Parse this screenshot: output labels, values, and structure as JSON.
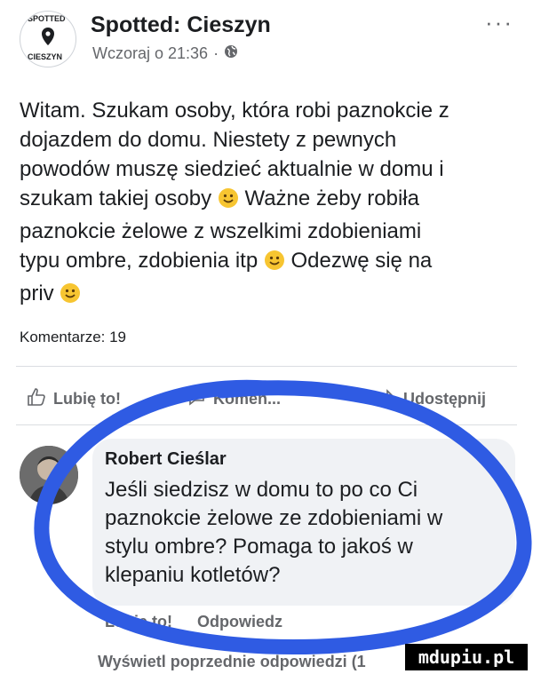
{
  "header": {
    "page_name": "Spotted: Cieszyn",
    "timestamp": "Wczoraj o 21:36",
    "separator": "·",
    "privacy_icon": "globe-icon",
    "more_label": "···",
    "logo_top_text": "SPOTTED",
    "logo_bottom_text": "CIESZYN"
  },
  "post": {
    "line1": "Witam. Szukam osoby, która robi paznokcie z",
    "line2": "dojazdem do domu. Niestety z pewnych",
    "line3": "powodów muszę siedzieć aktualnie w domu i",
    "line4a": "szukam takiej osoby",
    "line4b": "Ważne żeby robiła",
    "line5": "paznokcie żelowe z wszelkimi zdobieniami",
    "line6a": "typu ombre, zdobienia itp",
    "line6b": "Odezwę się na",
    "line7": "priv"
  },
  "stats": {
    "comments_label": "Komentarze: 19"
  },
  "actions": {
    "like": "Lubię to!",
    "comment": "Komen...",
    "share": "Udostępnij"
  },
  "comment": {
    "author": "Robert Cieślar",
    "line1": "Jeśli siedzisz w domu to po co Ci",
    "line2": "paznokcie żelowe ze zdobieniami w",
    "line3": "stylu ombre? Pomaga to jakoś w",
    "line4": "klepaniu kotletów?",
    "like": "Lubię to!",
    "reply": "Odpowiedz"
  },
  "more_replies": {
    "label": "Wyświetl poprzednie odpowiedzi (1"
  },
  "watermark": {
    "text": "mdupiu.pl"
  },
  "colors": {
    "highlight_circle": "#2f5be3",
    "secondary_text": "#65676b",
    "bubble_bg": "#f0f2f5"
  }
}
